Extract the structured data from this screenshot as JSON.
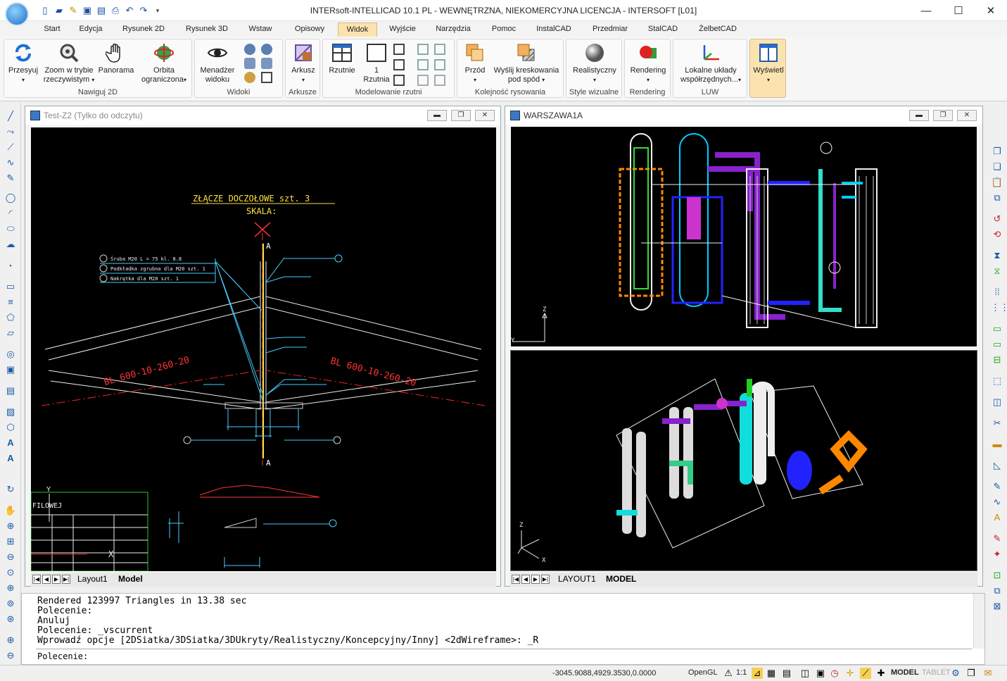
{
  "window": {
    "title": "INTERsoft-INTELLICAD 10.1 PL - WEWNĘTRZNA, NIEKOMERCYJNA LICENCJA - INTERSOFT [L01]",
    "minimize": "—",
    "maximize": "☐",
    "close": "✕"
  },
  "ribbon_tabs": [
    "Start",
    "Edycja",
    "Rysunek 2D",
    "Rysunek 3D",
    "Wstaw",
    "Opisowy",
    "Widok",
    "Wyjście",
    "Narzędzia",
    "Pomoc",
    "InstalCAD",
    "Przedmiar",
    "StalCAD",
    "ŻelbetCAD"
  ],
  "active_tab": "Widok",
  "ribbon": {
    "nawiguj": {
      "label": "Nawiguj 2D",
      "b1": "Przesyuj",
      "b2a": "Zoom w trybie",
      "b2b": "rzeczywistym",
      "b3": "Panorama",
      "b4a": "Orbita",
      "b4b": "ograniczona"
    },
    "widoki": {
      "label": "Widoki",
      "b1a": "Menadżer",
      "b1b": "widoku"
    },
    "arkusze": {
      "label": "Arkusze",
      "b1": "Arkusz"
    },
    "modelowanie": {
      "label": "Modelowanie rzutni",
      "b1": "Rzutnie",
      "b2a": "1",
      "b2b": "Rzutnia"
    },
    "kolejnosc": {
      "label": "Kolejność rysowania",
      "b1": "Przód",
      "b2a": "Wyślij kreskowania",
      "b2b": "pod spód"
    },
    "style": {
      "label": "Style wizualne",
      "b1": "Realistyczny"
    },
    "rendering": {
      "label": "Rendering",
      "b1": "Rendering"
    },
    "luw": {
      "label": "LUW",
      "b1a": "Lokalne układy",
      "b1b": "współrzędnych..."
    },
    "wyswietl": {
      "b1": "Wyświetl"
    }
  },
  "drawing1": {
    "title": "Test-Z2 (Tylko do odczytu)",
    "heading": "ZŁĄCZE DOCZOŁOWE szt. 3",
    "scale": "SKALA:",
    "section": "A",
    "beam_left": "BL 600-10-260-20",
    "beam_right": "BL 600-10-260-20",
    "leader1": "Śruba M20 L = 75 kl. 8.8",
    "leader2": "Podkładka zgrubna dla M20 szt. 1",
    "leader3": "Nakrętka dla M20 szt. 1",
    "table_title": "FILOWEJ",
    "tabs": [
      "Layout1",
      "Model"
    ],
    "active_tab": "Model"
  },
  "drawing2": {
    "title": "WARSZAWA1A",
    "tabs": [
      "LAYOUT1",
      "MODEL"
    ],
    "active_tab": "MODEL"
  },
  "command_line": {
    "history": [
      "Rendered 123997 Triangles in 13.38 sec",
      "Polecenie:",
      "Anuluj",
      "Polecenie: _vscurrent",
      "Wprowadź opcje [2DSiatka/3DSiatka/3DUkryty/Realistyczny/Koncepcyjny/Inny] <2dWireframe>: _R"
    ],
    "prompt": "Polecenie:"
  },
  "status": {
    "coords": "-3045.9088,4929.3530,0.0000",
    "renderer": "OpenGL",
    "scale": "1:1",
    "model": "MODEL",
    "tablet": "TABLET"
  }
}
